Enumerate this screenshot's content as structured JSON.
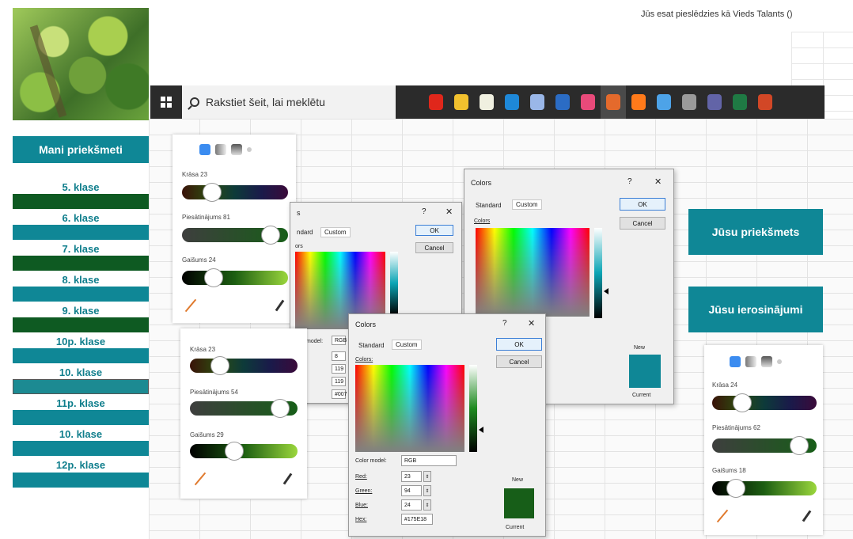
{
  "header": {
    "login_text": "Jūs esat pieslēdzies kā  Vieds Talants ()"
  },
  "taskbar": {
    "search_placeholder": "Rakstiet šeit, lai meklētu",
    "apps": [
      {
        "icon": "opera-icon",
        "color": "#e0271b"
      },
      {
        "icon": "save-disk-icon",
        "color": "#f2c12e"
      },
      {
        "icon": "store-bag-icon",
        "color": "#f0f0e0"
      },
      {
        "icon": "mail-icon",
        "color": "#1e88d8"
      },
      {
        "icon": "paint-icon",
        "color": "#9ab7e8"
      },
      {
        "icon": "word-icon",
        "color": "#2b6cc4"
      },
      {
        "icon": "keep-icon",
        "color": "#e84a7a"
      },
      {
        "icon": "photos-icon",
        "color": "#e46a2c"
      },
      {
        "icon": "firefox-icon",
        "color": "#ff7a1a"
      },
      {
        "icon": "chrome-icon",
        "color": "#4da3e8"
      },
      {
        "icon": "database-icon",
        "color": "#9a9a9a"
      },
      {
        "icon": "teams-icon",
        "color": "#6264a7"
      },
      {
        "icon": "excel-icon",
        "color": "#1f7a44"
      },
      {
        "icon": "powerpoint-icon",
        "color": "#d24726"
      }
    ]
  },
  "nav": {
    "header": "Mani priekšmeti",
    "items": [
      "5. klase",
      "6. klase",
      "7. klase",
      "8. klase",
      "9. klase",
      "10p. klase",
      "10. klase",
      "11p. klase",
      "10. klase",
      "12p. klase"
    ]
  },
  "right": {
    "subject_button": "Jūsu priekšmets",
    "suggestions_button": "Jūsu ierosinājumi"
  },
  "panels": [
    {
      "hue_label": "Krāsa",
      "hue_value": "23",
      "saturation_label": "Piesātinājums",
      "saturation_value": "81",
      "brightness_label": "Gaišums",
      "brightness_value": "24"
    },
    {
      "hue_label": "Krāsa",
      "hue_value": "23",
      "saturation_label": "Piesātinājums",
      "saturation_value": "54",
      "brightness_label": "Gaišums",
      "brightness_value": "29"
    },
    {
      "hue_label": "Krāsa",
      "hue_value": "24",
      "saturation_label": "Piesātinājums",
      "saturation_value": "62",
      "brightness_label": "Gaišums",
      "brightness_value": "18"
    }
  ],
  "dialog_back": {
    "title": "s",
    "help": "?",
    "close": "✕",
    "tab_standard": "ndard",
    "tab_custom": "Custom",
    "colors_label": "ors",
    "ok": "OK",
    "cancel": "Cancel",
    "model_label": "model:",
    "model_value": "RGB",
    "values": [
      "8",
      "119",
      "119",
      "#007"
    ]
  },
  "dialog_right": {
    "title": "Colors",
    "help": "?",
    "close": "✕",
    "tab_standard": "Standard",
    "tab_custom": "Custom",
    "colors_label": "Colors",
    "ok": "OK",
    "cancel": "Cancel",
    "new_label": "New",
    "current_label": "Current",
    "preview_color": "#0f8796"
  },
  "dialog_front": {
    "title": "Colors",
    "help": "?",
    "close": "✕",
    "tab_standard": "Standard",
    "tab_custom": "Custom",
    "colors_label": "Colors:",
    "ok": "OK",
    "cancel": "Cancel",
    "model_label": "Color model:",
    "model_value": "RGB",
    "red_label": "Red:",
    "red_value": "23",
    "green_label": "Green:",
    "green_value": "94",
    "blue_label": "Blue:",
    "blue_value": "24",
    "hex_label": "Hex:",
    "hex_value": "#175E18",
    "new_label": "New",
    "current_label": "Current",
    "preview_color": "#175e18"
  }
}
